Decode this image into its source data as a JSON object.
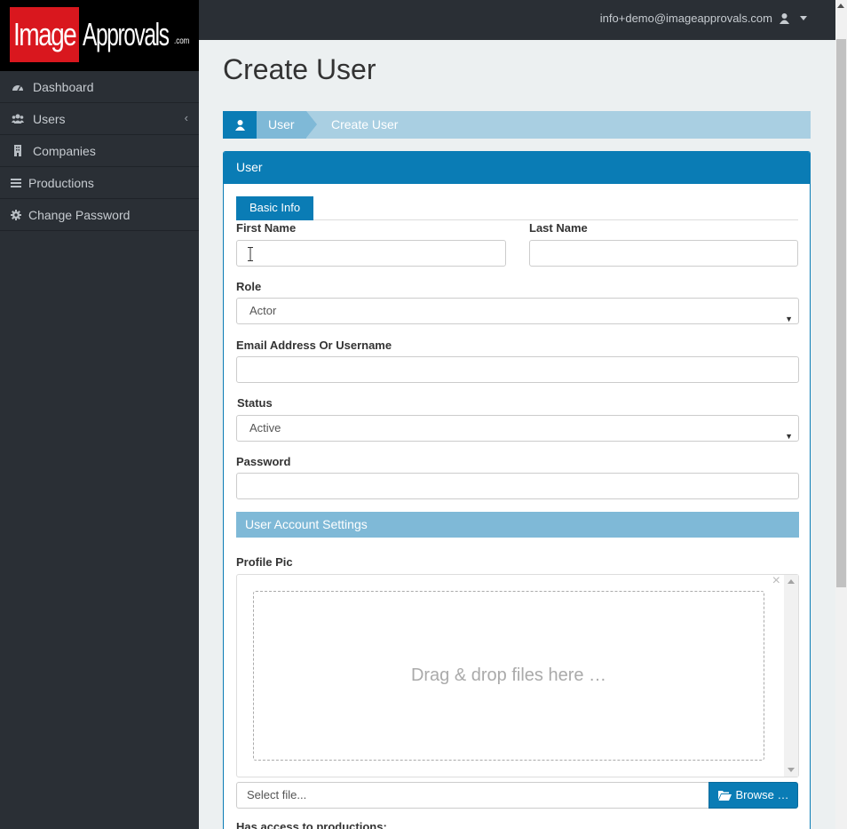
{
  "app": {
    "logo_main": "Image",
    "logo_second": "Approvals",
    "logo_suffix": ".com",
    "accent_color": "#0a7cb5",
    "logo_color": "#d9171e"
  },
  "sidebar": {
    "items": [
      {
        "label": "Dashboard",
        "icon": "dashboard-icon"
      },
      {
        "label": "Users",
        "icon": "users-icon"
      },
      {
        "label": "Companies",
        "icon": "building-icon"
      },
      {
        "label": "Productions",
        "icon": "list-icon"
      },
      {
        "label": "Change Password",
        "icon": "gear-icon"
      }
    ]
  },
  "header": {
    "user_email": "info+demo@imageapprovals.com"
  },
  "page": {
    "title": "Create User",
    "breadcrumb": [
      "User",
      "Create User"
    ]
  },
  "panel": {
    "title": "User",
    "tab": "Basic Info"
  },
  "form": {
    "first_name_label": "First Name",
    "last_name_label": "Last Name",
    "role_label": "Role",
    "role_value": "Actor",
    "email_label": "Email Address Or Username",
    "status_label": "Status",
    "status_value": "Active",
    "password_label": "Password",
    "section_title": "User Account Settings",
    "profile_pic_label": "Profile Pic",
    "dropzone_text": "Drag & drop files here …",
    "file_placeholder": "Select file...",
    "browse_label": "Browse …",
    "access_label": "Has access to productions:"
  }
}
